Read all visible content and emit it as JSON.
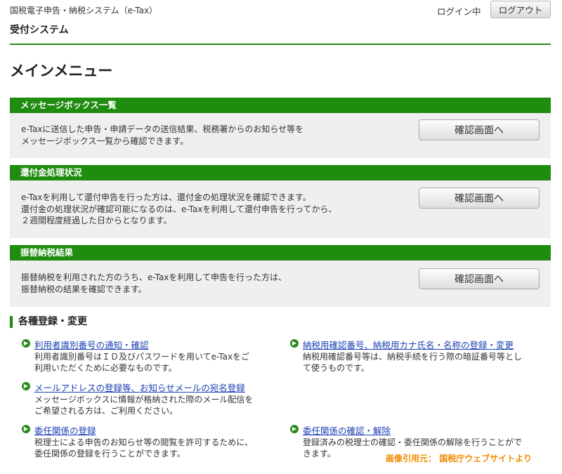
{
  "header": {
    "system_name": "国税電子申告・納税システム（e-Tax）",
    "subtitle": "受付システム",
    "login_status": "ログイン中",
    "logout_label": "ログアウト"
  },
  "page_title": "メインメニュー",
  "panels": [
    {
      "title": "メッセージボックス一覧",
      "description": "e-Taxに送信した申告・申請データの送信結果、税務署からのお知らせ等を\nメッセージボックス一覧から確認できます。",
      "button": "確認画面へ"
    },
    {
      "title": "還付金処理状況",
      "description": "e-Taxを利用して還付申告を行った方は、還付金の処理状況を確認できます。\n還付金の処理状況が確認可能になるのは、e-Taxを利用して還付申告を行ってから、\n２週間程度経過した日からとなります。",
      "button": "確認画面へ"
    },
    {
      "title": "振替納税結果",
      "description": "振替納税を利用された方のうち、e-Taxを利用して申告を行った方は、\n振替納税の結果を確認できます。",
      "button": "確認画面へ"
    }
  ],
  "registration": {
    "title": "各種登録・変更",
    "items": [
      {
        "link": "利用者識別番号の通知・確認",
        "description": "利用者識別番号はＩＤ及びパスワードを用いてe-Taxをご\n利用いただくために必要なものです。"
      },
      {
        "link": "納税用確認番号、納税用カナ氏名・名称の登録・変更",
        "description": "納税用確認番号等は、納税手続を行う際の暗証番号等とし\nて使うものです。"
      },
      {
        "link": "メールアドレスの登録等、お知らせメールの宛名登録",
        "description": "メッセージボックスに情報が格納された際のメール配信を\nご希望される方は、ご利用ください。"
      },
      {
        "link": "委任関係の登録",
        "description": "税理士による申告のお知らせ等の閲覧を許可するために、\n委任関係の登録を行うことができます。"
      },
      {
        "link": "委任関係の確認・解除",
        "description": "登録済みの税理士の確認・委任関係の解除を行うことがで\nきます。"
      }
    ]
  },
  "credit": "画像引用元： 国税庁ウェブサイトより",
  "colors": {
    "accent_green": "#1f8b0f",
    "link_blue": "#1a3fb3",
    "credit_orange": "#f08c00",
    "panel_bg": "#efefef"
  },
  "icons": {
    "logout": "none",
    "link_bullet": "circle-arrow-right-icon"
  }
}
